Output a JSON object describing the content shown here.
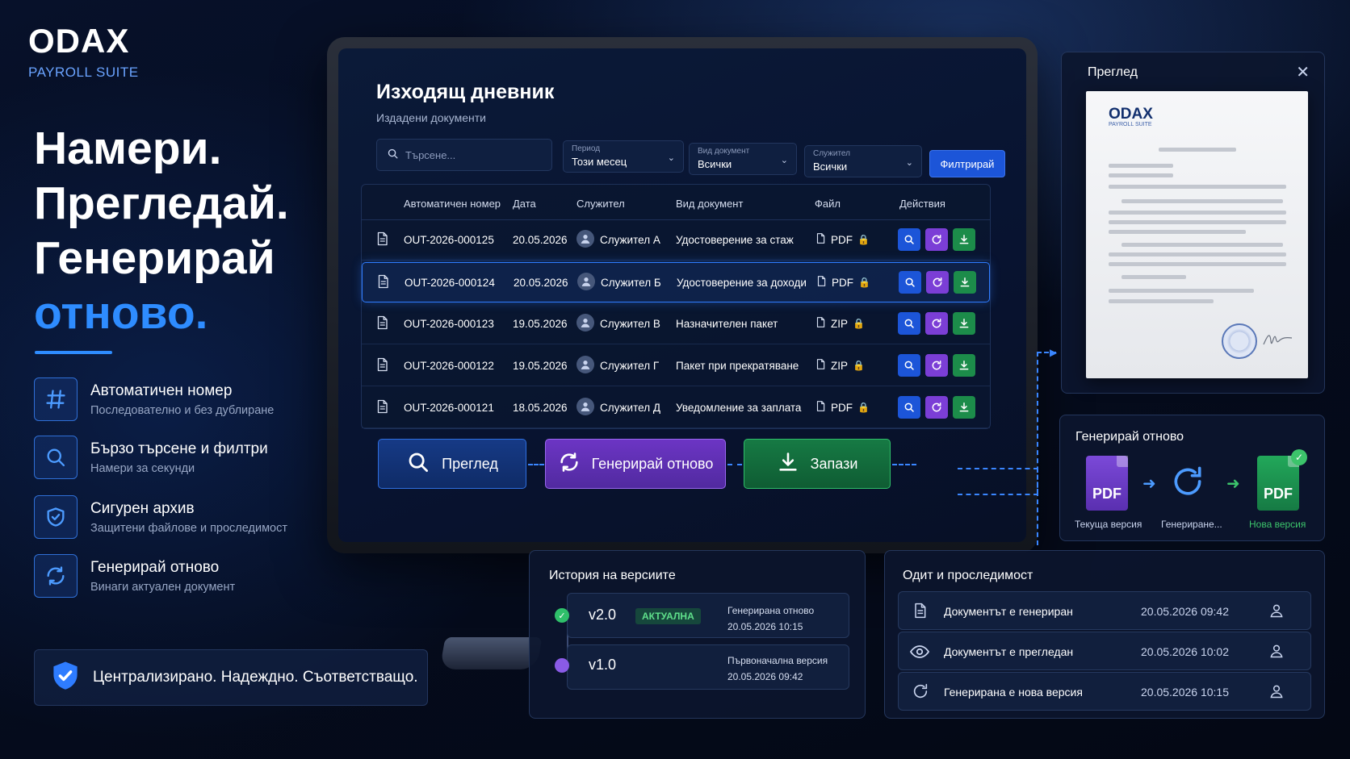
{
  "brand": {
    "name": "ODAX",
    "subtitle": "PAYROLL SUITE"
  },
  "hero": {
    "line1": "Намери.",
    "line2": "Прегледай.",
    "line3": "Генерирай",
    "line4": "отново."
  },
  "features": [
    {
      "title": "Автоматичен номер",
      "subtitle": "Последователно и без дублиране",
      "icon": "hash-icon"
    },
    {
      "title": "Бързо търсене и филтри",
      "subtitle": "Намери за секунди",
      "icon": "search-icon"
    },
    {
      "title": "Сигурен архив",
      "subtitle": "Защитени файлове и проследимост",
      "icon": "shield-icon"
    },
    {
      "title": "Генерирай отново",
      "subtitle": "Винаги актуален документ",
      "icon": "refresh-icon"
    }
  ],
  "banner": {
    "text": "Централизирано. Надеждно. Съответстващо."
  },
  "screen": {
    "title": "Изходящ дневник",
    "subtitle": "Издадени документи",
    "search_placeholder": "Търсене...",
    "filters": {
      "period": {
        "label": "Период",
        "value": "Този месец"
      },
      "doc_type": {
        "label": "Вид документ",
        "value": "Всички"
      },
      "employee": {
        "label": "Служител",
        "value": "Всички"
      },
      "button": "Филтрирай"
    },
    "columns": [
      "Автоматичен номер",
      "Дата",
      "Служител",
      "Вид документ",
      "Файл",
      "Действия"
    ],
    "rows": [
      {
        "number": "OUT-2026-000125",
        "date": "20.05.2026",
        "employee": "Служител А",
        "type": "Удостоверение за стаж",
        "file": "PDF"
      },
      {
        "number": "OUT-2026-000124",
        "date": "20.05.2026",
        "employee": "Служител Б",
        "type": "Удостоверение за доходи",
        "file": "PDF"
      },
      {
        "number": "OUT-2026-000123",
        "date": "19.05.2026",
        "employee": "Служител В",
        "type": "Назначителен пакет",
        "file": "ZIP"
      },
      {
        "number": "OUT-2026-000122",
        "date": "19.05.2026",
        "employee": "Служител Г",
        "type": "Пакет при прекратяване",
        "file": "ZIP"
      },
      {
        "number": "OUT-2026-000121",
        "date": "18.05.2026",
        "employee": "Служител Д",
        "type": "Уведомление за заплата",
        "file": "PDF"
      }
    ],
    "selected_row": 1,
    "buttons": {
      "preview": "Преглед",
      "regenerate": "Генерирай отново",
      "save": "Запази"
    }
  },
  "preview_panel": {
    "title": "Преглед",
    "doc_brand": "ODAX",
    "doc_brand_sub": "PAYROLL SUITE"
  },
  "regen_panel": {
    "title": "Генерирай отново",
    "current_label": "Текуща версия",
    "generating_label": "Генериране...",
    "new_label": "Нова версия",
    "file_label": "PDF"
  },
  "history": {
    "title": "История на версиите",
    "items": [
      {
        "version": "v2.0",
        "badge": "АКТУАЛНА",
        "note": "Генерирана отново",
        "time": "20.05.2026 10:15"
      },
      {
        "version": "v1.0",
        "note": "Първоначална версия",
        "time": "20.05.2026 09:42"
      }
    ]
  },
  "audit": {
    "title": "Одит и проследимост",
    "items": [
      {
        "event": "Документът е генериран",
        "time": "20.05.2026 09:42",
        "icon": "document-icon"
      },
      {
        "event": "Документът е прегледан",
        "time": "20.05.2026 10:02",
        "icon": "eye-icon"
      },
      {
        "event": "Генерирана е нова версия",
        "time": "20.05.2026 10:15",
        "icon": "refresh-icon"
      }
    ]
  },
  "colors": {
    "accent": "#2e8cff",
    "purple": "#7b3ed6",
    "green": "#1c8c4a",
    "bg": "#050c1e"
  }
}
